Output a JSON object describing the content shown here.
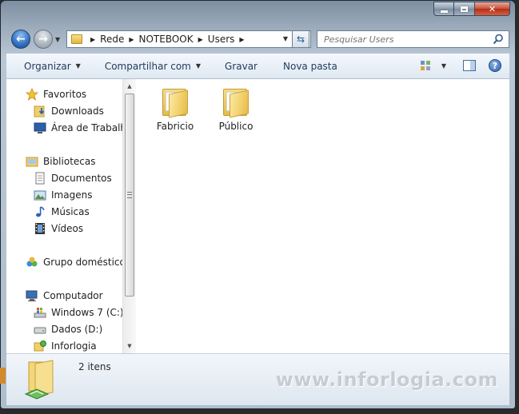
{
  "address": {
    "breadcrumbs": [
      "Rede",
      "NOTEBOOK",
      "Users"
    ]
  },
  "search": {
    "placeholder": "Pesquisar Users"
  },
  "toolbar": {
    "organize": "Organizar",
    "share": "Compartilhar com",
    "burn": "Gravar",
    "new_folder": "Nova pasta"
  },
  "sidebar": {
    "favorites": {
      "label": "Favoritos",
      "items": [
        {
          "label": "Downloads",
          "icon": "downloads-folder-icon"
        },
        {
          "label": "Área de Trabalho",
          "icon": "desktop-icon"
        }
      ]
    },
    "libraries": {
      "label": "Bibliotecas",
      "items": [
        {
          "label": "Documentos",
          "icon": "documents-icon"
        },
        {
          "label": "Imagens",
          "icon": "pictures-icon"
        },
        {
          "label": "Músicas",
          "icon": "music-icon"
        },
        {
          "label": "Vídeos",
          "icon": "videos-icon"
        }
      ]
    },
    "homegroup": {
      "label": "Grupo doméstico"
    },
    "computer": {
      "label": "Computador",
      "items": [
        {
          "label": "Windows 7 (C:)",
          "icon": "windows-drive-icon"
        },
        {
          "label": "Dados (D:)",
          "icon": "hard-drive-icon"
        },
        {
          "label": "Inforlogia",
          "icon": "network-drive-icon"
        }
      ]
    }
  },
  "files": [
    {
      "name": "Fabricio",
      "icon": "folder-icon"
    },
    {
      "name": "Público",
      "icon": "folder-icon"
    }
  ],
  "details": {
    "count": "2 itens"
  },
  "watermark": "www.inforlogia.com",
  "colors": {
    "accent": "#2c5e96",
    "folder": "#f2cf6a",
    "close": "#c9503c"
  }
}
